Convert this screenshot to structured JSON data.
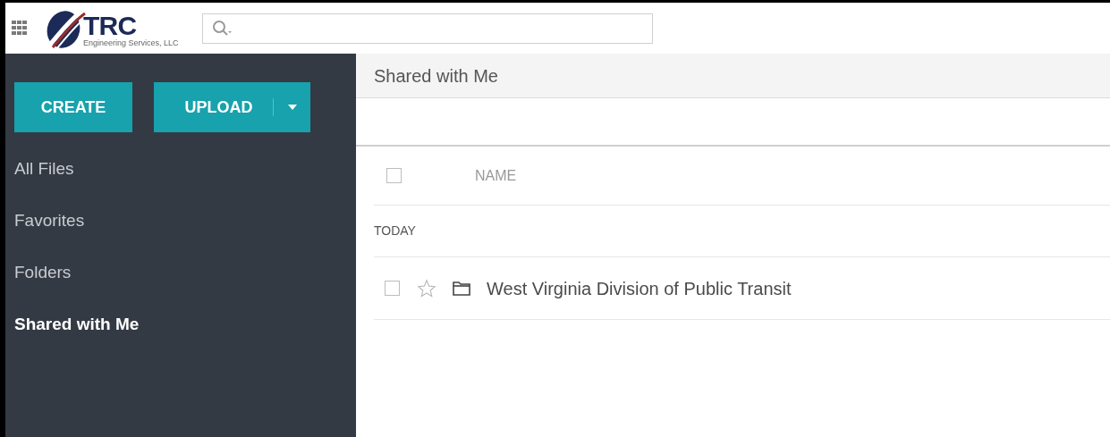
{
  "logo": {
    "title": "TRC",
    "subtitle": "Engineering Services, LLC"
  },
  "actions": {
    "create": "CREATE",
    "upload": "UPLOAD"
  },
  "sidebar": {
    "items": [
      {
        "label": "All Files",
        "selected": false
      },
      {
        "label": "Favorites",
        "selected": false
      },
      {
        "label": "Folders",
        "selected": false
      },
      {
        "label": "Shared with Me",
        "selected": true
      }
    ]
  },
  "page_title": "Shared with Me",
  "table": {
    "select_all_checked": false,
    "columns": [
      "NAME"
    ],
    "groups": [
      {
        "label": "TODAY",
        "rows": [
          {
            "kind": "folder",
            "name": "West Virginia Division of Public Transit",
            "checked": false,
            "favorite": false
          }
        ]
      }
    ]
  }
}
